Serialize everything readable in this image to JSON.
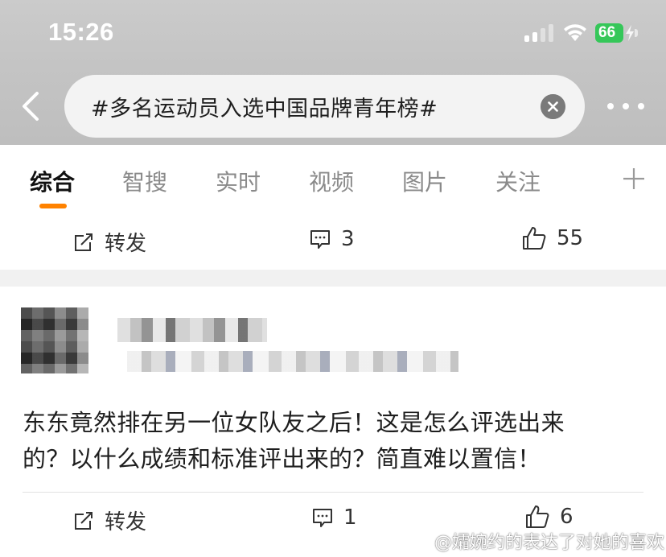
{
  "status_bar": {
    "time": "15:26",
    "battery_level": "66",
    "signal_icon": "cellular-signal-icon",
    "wifi_icon": "wifi-icon"
  },
  "search": {
    "query": "#多名运动员入选中国品牌青年榜#"
  },
  "tabs": [
    {
      "label": "综合",
      "active": true
    },
    {
      "label": "智搜"
    },
    {
      "label": "实时"
    },
    {
      "label": "视频"
    },
    {
      "label": "图片"
    },
    {
      "label": "关注"
    }
  ],
  "posts": [
    {
      "repost_label": "转发",
      "comment_count": "3",
      "like_count": "55"
    },
    {
      "text_line1": "东东竟然排在另一位女队友之后！这是怎么评选出来",
      "text_line2": "的？以什么成绩和标准评出来的？简直难以置信！",
      "repost_label": "转发",
      "comment_count": "1",
      "like_count": "6"
    }
  ],
  "watermark": {
    "text": "@孀婉约的表达了对她的喜欢"
  },
  "colors": {
    "accent": "#ff8200",
    "battery": "#35c759",
    "header_bg": "#c6c6c6"
  }
}
